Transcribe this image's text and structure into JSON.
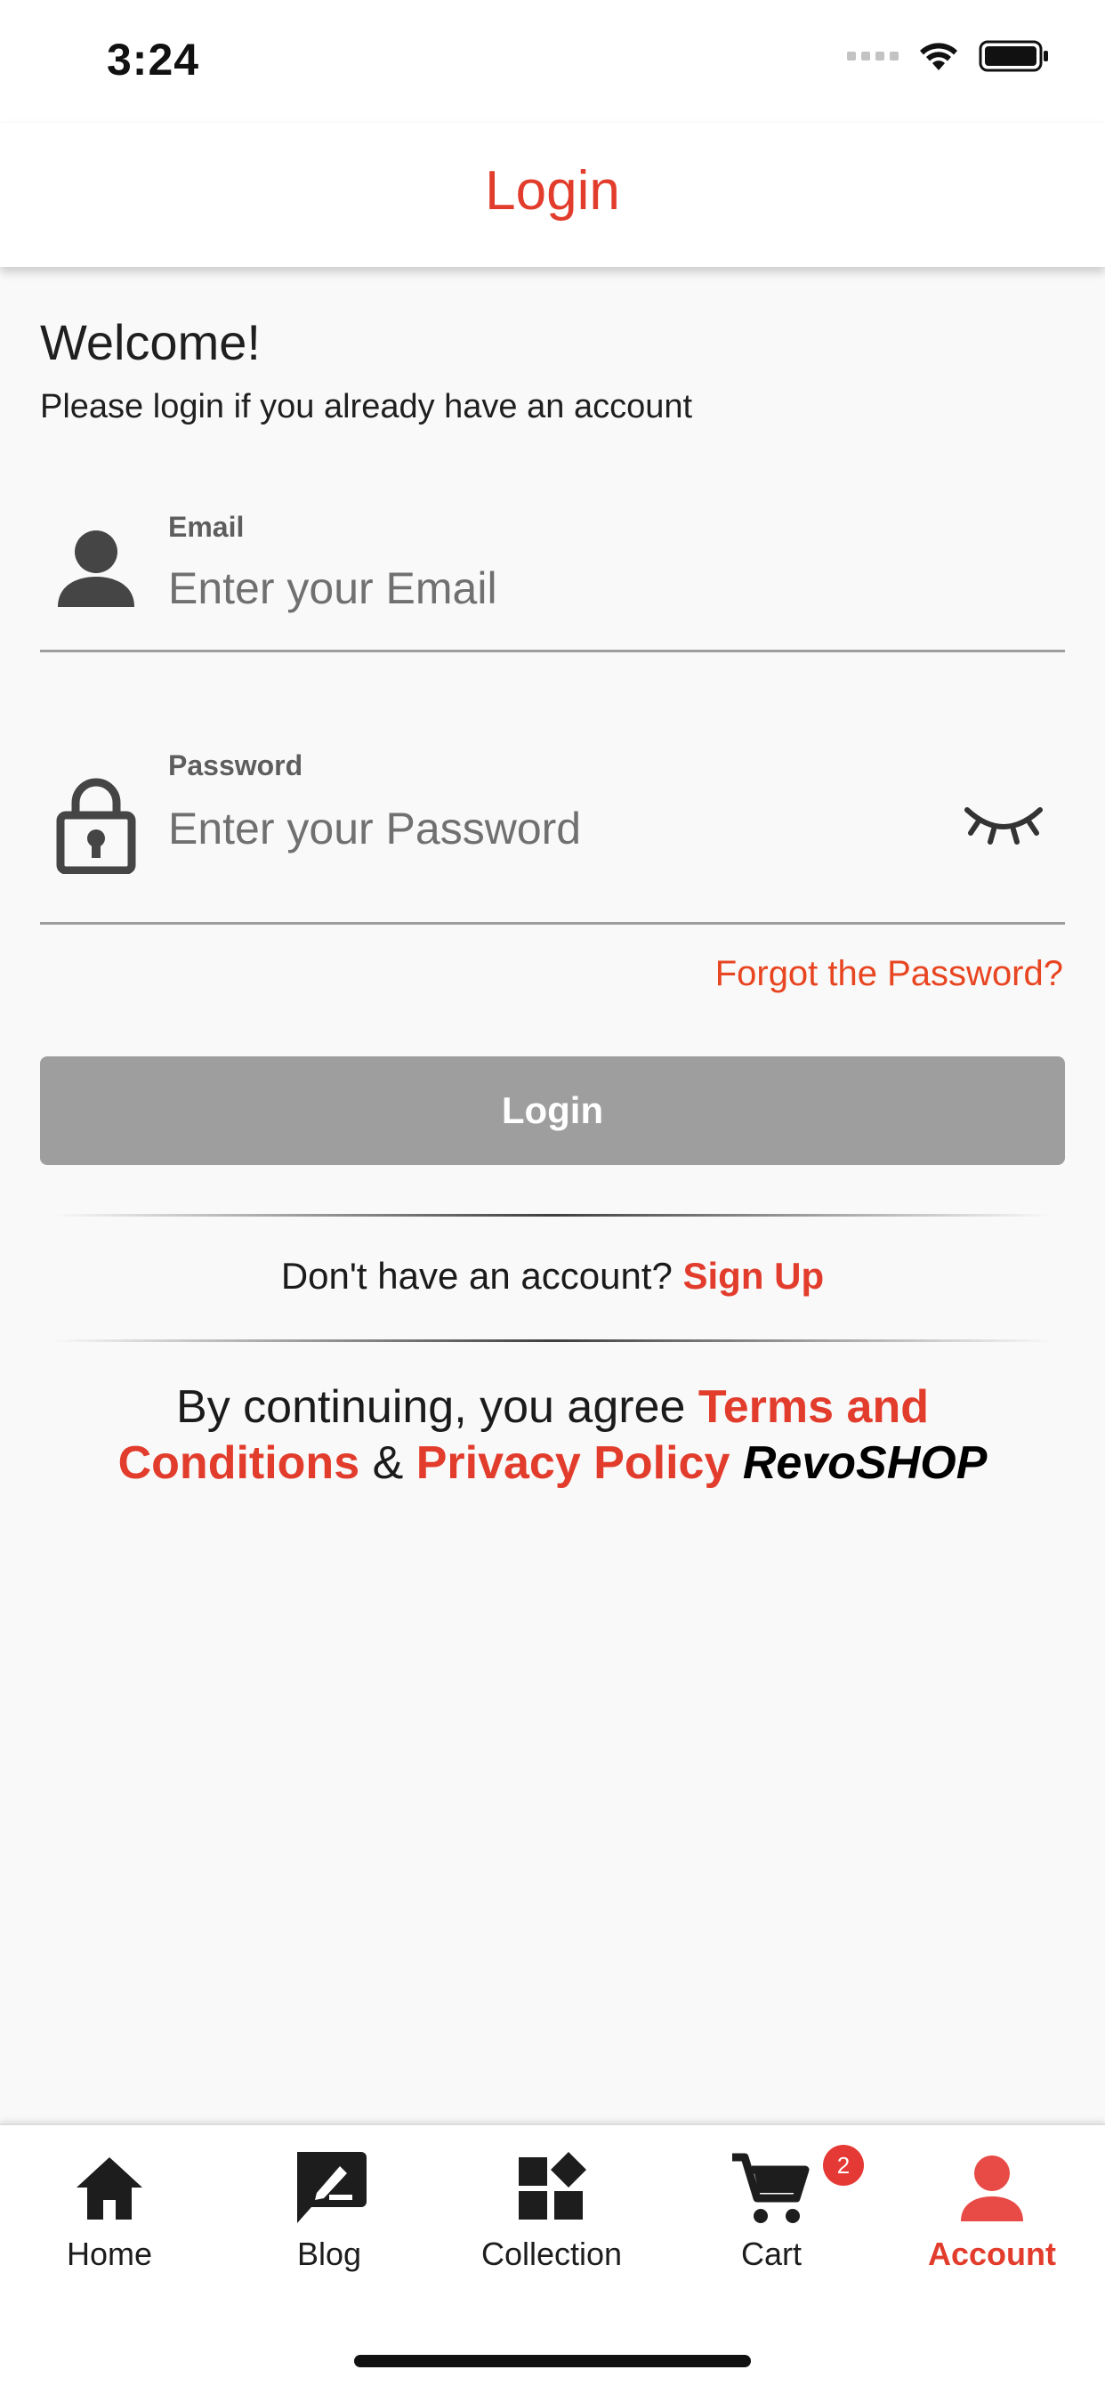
{
  "status_bar": {
    "time": "3:24"
  },
  "app_bar": {
    "title": "Login"
  },
  "welcome": {
    "title": "Welcome!",
    "subtitle": "Please login if you already have an account"
  },
  "form": {
    "email": {
      "label": "Email",
      "placeholder": "Enter your Email",
      "value": ""
    },
    "password": {
      "label": "Password",
      "placeholder": "Enter your Password",
      "value": ""
    },
    "forgot_label": "Forgot the Password?",
    "login_label": "Login"
  },
  "signup": {
    "prompt": "Don't have an account?",
    "link": "Sign Up"
  },
  "terms": {
    "prefix": "By continuing, you agree",
    "terms_link": "Terms and Conditions",
    "ampersand": "&",
    "privacy_link": "Privacy Policy",
    "brand": "RevoSHOP"
  },
  "bottom_nav": {
    "items": [
      {
        "label": "Home",
        "icon": "home-icon"
      },
      {
        "label": "Blog",
        "icon": "blog-icon"
      },
      {
        "label": "Collection",
        "icon": "collection-icon"
      },
      {
        "label": "Cart",
        "icon": "cart-icon",
        "badge": "2"
      },
      {
        "label": "Account",
        "icon": "account-icon",
        "active": true
      }
    ]
  },
  "colors": {
    "accent": "#e23c2c",
    "link_orange": "#e84521",
    "button_disabled": "#9e9e9e",
    "badge": "#e53935"
  }
}
